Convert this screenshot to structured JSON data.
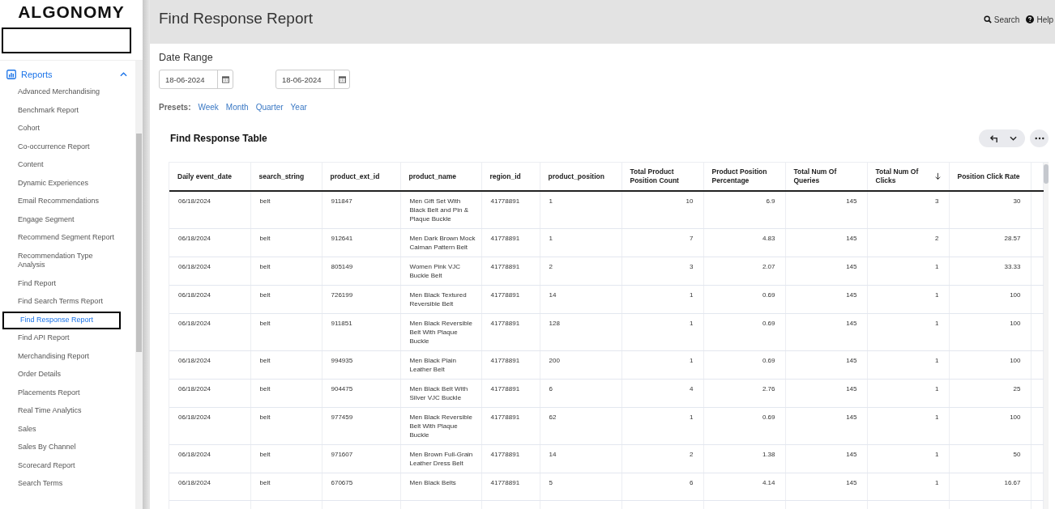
{
  "logo": {
    "text": "ALGONOMY"
  },
  "sidebar": {
    "section": {
      "label": "Reports",
      "expanded": true
    },
    "items": [
      {
        "label": "Advanced Merchandising",
        "selected": false
      },
      {
        "label": "Benchmark Report",
        "selected": false
      },
      {
        "label": "Cohort",
        "selected": false
      },
      {
        "label": "Co-occurrence Report",
        "selected": false
      },
      {
        "label": "Content",
        "selected": false
      },
      {
        "label": "Dynamic Experiences",
        "selected": false
      },
      {
        "label": "Email Recommendations",
        "selected": false
      },
      {
        "label": "Engage Segment",
        "selected": false
      },
      {
        "label": "Recommend Segment Report",
        "selected": false
      },
      {
        "label": "Recommendation Type Analysis",
        "selected": false
      },
      {
        "label": "Find Report",
        "selected": false
      },
      {
        "label": "Find Search Terms Report",
        "selected": false
      },
      {
        "label": "Find Response Report",
        "selected": true
      },
      {
        "label": "Find API Report",
        "selected": false
      },
      {
        "label": "Merchandising Report",
        "selected": false
      },
      {
        "label": "Order Details",
        "selected": false
      },
      {
        "label": "Placements Report",
        "selected": false
      },
      {
        "label": "Real Time Analytics",
        "selected": false
      },
      {
        "label": "Sales",
        "selected": false
      },
      {
        "label": "Sales By Channel",
        "selected": false
      },
      {
        "label": "Scorecard Report",
        "selected": false
      },
      {
        "label": "Search Terms",
        "selected": false
      }
    ]
  },
  "header": {
    "title": "Find Response Report",
    "links": [
      {
        "kind": "search",
        "label": "Search"
      },
      {
        "kind": "help",
        "label": "Help"
      }
    ]
  },
  "date_range": {
    "title": "Date Range",
    "start": "18-06-2024",
    "end": "18-06-2024",
    "presets_label": "Presets:",
    "presets": [
      "Week",
      "Month",
      "Quarter",
      "Year"
    ]
  },
  "table": {
    "title": "Find Response Table",
    "columns": [
      {
        "label": "Daily event_date",
        "kind": "text",
        "sorted": false
      },
      {
        "label": "search_string",
        "kind": "text",
        "sorted": false
      },
      {
        "label": "product_ext_id",
        "kind": "text",
        "sorted": false
      },
      {
        "label": "product_name",
        "kind": "text",
        "sorted": false
      },
      {
        "label": "region_id",
        "kind": "text",
        "sorted": false
      },
      {
        "label": "product_position",
        "kind": "text",
        "sorted": false
      },
      {
        "label": "Total Product Position Count",
        "kind": "number",
        "sorted": false
      },
      {
        "label": "Product Position Percentage",
        "kind": "number",
        "sorted": false
      },
      {
        "label": "Total Num Of Queries",
        "kind": "number",
        "sorted": false
      },
      {
        "label": "Total Num Of Clicks",
        "kind": "number",
        "sorted": true
      },
      {
        "label": "Position Click Rate",
        "kind": "number",
        "sorted": false
      }
    ],
    "rows": [
      [
        "06/18/2024",
        "belt",
        "911847",
        "Men Gift Set With Black Belt and Pin & Plaque Buckle",
        "41778891",
        "1",
        "10",
        "6.9",
        "145",
        "3",
        "30"
      ],
      [
        "06/18/2024",
        "belt",
        "912641",
        "Men Dark Brown Mock Caiman Pattern Belt",
        "41778891",
        "1",
        "7",
        "4.83",
        "145",
        "2",
        "28.57"
      ],
      [
        "06/18/2024",
        "belt",
        "805149",
        "Women Pink VJC Buckle Belt",
        "41778891",
        "2",
        "3",
        "2.07",
        "145",
        "1",
        "33.33"
      ],
      [
        "06/18/2024",
        "belt",
        "726199",
        "Men Black Textured Reversible Belt",
        "41778891",
        "14",
        "1",
        "0.69",
        "145",
        "1",
        "100"
      ],
      [
        "06/18/2024",
        "belt",
        "911851",
        "Men Black Reversible Belt With Plaque Buckle",
        "41778891",
        "128",
        "1",
        "0.69",
        "145",
        "1",
        "100"
      ],
      [
        "06/18/2024",
        "belt",
        "994935",
        "Men Black Plain Leather Belt",
        "41778891",
        "200",
        "1",
        "0.69",
        "145",
        "1",
        "100"
      ],
      [
        "06/18/2024",
        "belt",
        "904475",
        "Men Black Belt With Silver VJC Buckle",
        "41778891",
        "6",
        "4",
        "2.76",
        "145",
        "1",
        "25"
      ],
      [
        "06/18/2024",
        "belt",
        "977459",
        "Men Black Reversible Belt With Plaque Buckle",
        "41778891",
        "62",
        "1",
        "0.69",
        "145",
        "1",
        "100"
      ],
      [
        "06/18/2024",
        "belt",
        "971607",
        "Men Brown Full-Grain Leather Dress Belt",
        "41778891",
        "14",
        "2",
        "1.38",
        "145",
        "1",
        "50"
      ],
      [
        "06/18/2024",
        "belt",
        "670675",
        "Men Black Belts",
        "41778891",
        "5",
        "6",
        "4.14",
        "145",
        "1",
        "16.67"
      ]
    ]
  }
}
